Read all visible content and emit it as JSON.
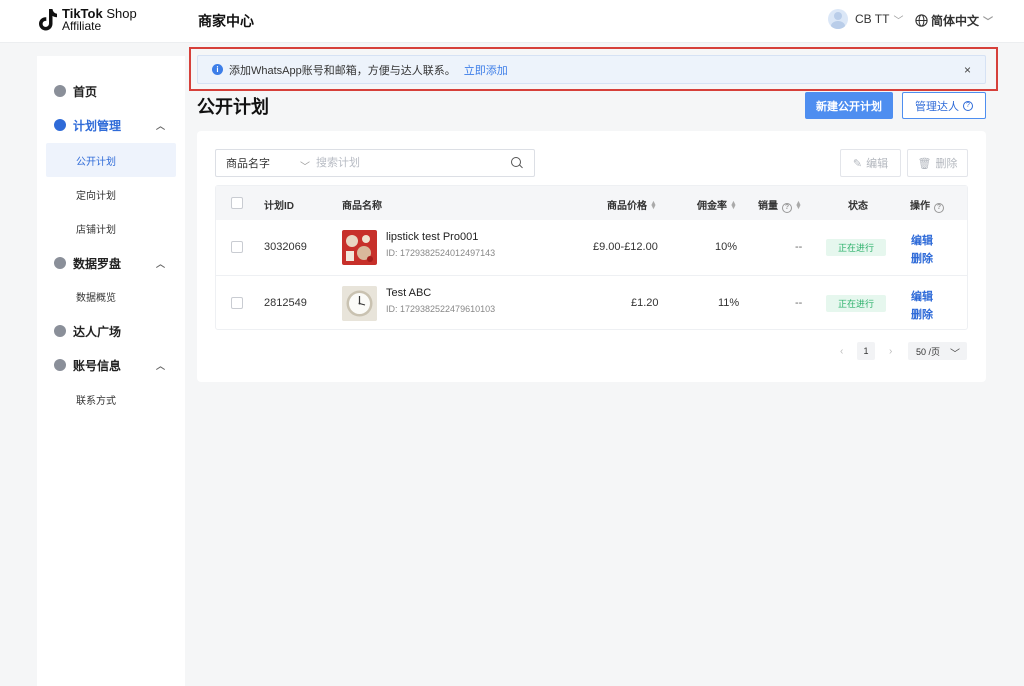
{
  "header": {
    "logo_brand": "TikTok",
    "logo_shop": "Shop",
    "logo_affiliate": "Affiliate",
    "title": "商家中心",
    "user_name": "CB TT",
    "language": "简体中文"
  },
  "sidebar": {
    "items": [
      {
        "label": "首页",
        "icon": "home-icon"
      },
      {
        "label": "计划管理",
        "icon": "plan-icon"
      },
      {
        "label": "公开计划"
      },
      {
        "label": "定向计划"
      },
      {
        "label": "店铺计划"
      },
      {
        "label": "数据罗盘",
        "icon": "compass-icon"
      },
      {
        "label": "数据概览"
      },
      {
        "label": "达人广场",
        "icon": "search-creator-icon"
      },
      {
        "label": "账号信息",
        "icon": "account-icon"
      },
      {
        "label": "联系方式"
      }
    ]
  },
  "alert": {
    "message": "添加WhatsApp账号和邮箱，方便与达人联系。",
    "link": "立即添加",
    "close": "×"
  },
  "page": {
    "title": "公开计划",
    "create_button": "新建公开计划",
    "manage_button": "管理达人",
    "help_glyph": "?"
  },
  "toolbar": {
    "filter_field": "商品名字",
    "search_placeholder": "搜索计划",
    "edit_button": "编辑",
    "delete_button": "删除"
  },
  "table": {
    "columns": [
      "计划ID",
      "商品名称",
      "商品价格",
      "佣金率",
      "销量",
      "状态",
      "操作"
    ],
    "rows": [
      {
        "plan_id": "3032069",
        "name": "lipstick test Pro001",
        "product_id": "ID: 1729382524012497143",
        "price": "£9.00-£12.00",
        "commission": "10%",
        "sales": "--",
        "status": "正在进行",
        "action_edit": "编辑",
        "action_delete": "删除"
      },
      {
        "plan_id": "2812549",
        "name": "Test ABC",
        "product_id": "ID: 1729382522479610103",
        "price": "£1.20",
        "commission": "11%",
        "sales": "--",
        "status": "正在进行",
        "action_edit": "编辑",
        "action_delete": "删除"
      }
    ]
  },
  "pagination": {
    "prev": "‹",
    "current": "1",
    "next": "›",
    "page_size": "50 /页"
  },
  "colors": {
    "accent": "#2f6bd8",
    "primary_button": "#4e8ef0",
    "status_green": "#2bb06a",
    "highlight_border": "#d6403a"
  }
}
